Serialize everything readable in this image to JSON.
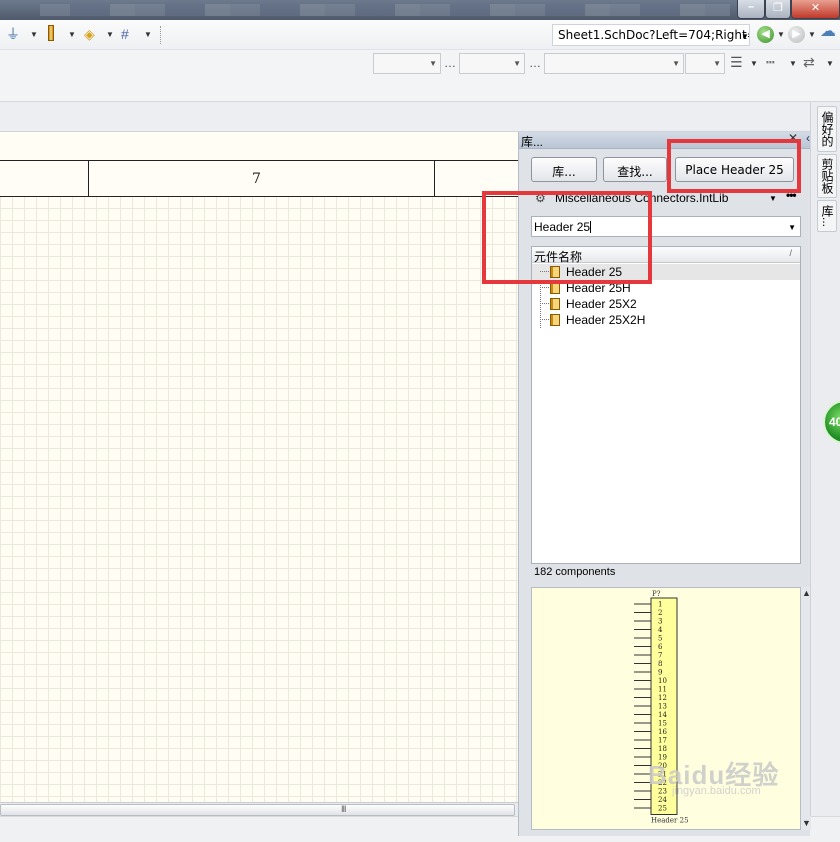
{
  "colors": {
    "accent_red": "#e4383d",
    "schematic_bg": "#fffdf4",
    "preview_bg": "#ffffe0",
    "panel_bg": "#dfe3e8"
  },
  "toolbar": {
    "doc_path": "Sheet1.SchDoc?Left=704;Right=",
    "icons": [
      "ground-icon",
      "probe-icon",
      "junction-icon",
      "grid-icon",
      "back-icon",
      "forward-icon",
      "network-icon"
    ]
  },
  "schematic": {
    "zone_label": "7",
    "scrollbar_grip": "III"
  },
  "library_panel": {
    "title": "库...",
    "buttons": {
      "library": "库...",
      "search": "查找...",
      "place": "Place Header 25"
    },
    "library_name": "Miscellaneous Connectors.IntLib",
    "more": "•••",
    "filter_value": "Header 25",
    "list_header": "元件名称",
    "components": [
      "Header 25",
      "Header 25H",
      "Header 25X2",
      "Header 25X2H"
    ],
    "selected_index": 0,
    "count_text": "182 components",
    "preview": {
      "designator": "P?",
      "pins": [
        "1",
        "2",
        "3",
        "4",
        "5",
        "6",
        "7",
        "8",
        "9",
        "10",
        "11",
        "12",
        "13",
        "14",
        "15",
        "16",
        "17",
        "18",
        "19",
        "20",
        "21",
        "22",
        "23",
        "24",
        "25"
      ],
      "part_name": "Header 25"
    }
  },
  "side_tabs": [
    "偏好的",
    "剪贴板",
    "库..."
  ],
  "badge": "40",
  "watermark": {
    "main": "Baidu经验",
    "sub": "jingyan.baidu.com"
  }
}
